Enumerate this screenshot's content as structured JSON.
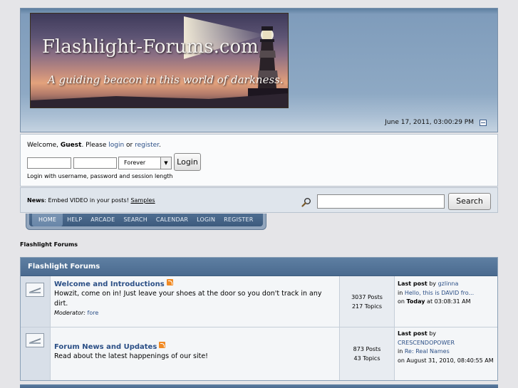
{
  "header": {
    "banner_title": "Flashlight-Forums.com",
    "banner_tagline": "A guiding beacon in this world of darkness.",
    "datetime": "June 17, 2011, 03:00:29 PM"
  },
  "login": {
    "welcome_prefix": "Welcome, ",
    "guest": "Guest",
    "please": ". Please ",
    "login_link": "login",
    "or": " or ",
    "register_link": "register",
    "period": ".",
    "session_length": "Forever",
    "login_button": "Login",
    "hint": "Login with username, password and session length"
  },
  "news": {
    "label": "News",
    "text": ": Embed VIDEO in your posts! ",
    "samples_link": "Samples"
  },
  "search": {
    "button": "Search"
  },
  "nav": {
    "items": [
      "HOME",
      "HELP",
      "ARCADE",
      "SEARCH",
      "CALENDAR",
      "LOGIN",
      "REGISTER"
    ]
  },
  "breadcrumb": "Flashlight Forums",
  "category": {
    "title": "Flashlight Forums",
    "boards": [
      {
        "name": "Welcome and Introductions",
        "description": "Howzit, come on in! Just leave your shoes at the door so you don't track in any dirt.",
        "moderator_label": "Moderator: ",
        "moderator": "fore",
        "posts": "3037 Posts",
        "topics": "217 Topics",
        "last_post_label": "Last post",
        "by": " by ",
        "last_poster": "gzlinna",
        "in": "in ",
        "last_topic": "Hello, this is DAVID fro...",
        "on": "on ",
        "last_date_bold": "Today",
        "last_date_rest": " at 03:08:31 AM"
      },
      {
        "name": "Forum News and Updates",
        "description": "Read about the latest happenings of our site!",
        "posts": "873 Posts",
        "topics": "43 Topics",
        "last_post_label": "Last post",
        "by": " by",
        "last_poster": "CRESCENDOPOWER",
        "in": "in ",
        "last_topic": "Re: Real Names",
        "last_date": "on August 31, 2010, 08:40:55 AM"
      }
    ]
  },
  "colors": {
    "link": "#2b4f86",
    "category_header": "#4a6a8f",
    "rss": "#f08a24"
  }
}
